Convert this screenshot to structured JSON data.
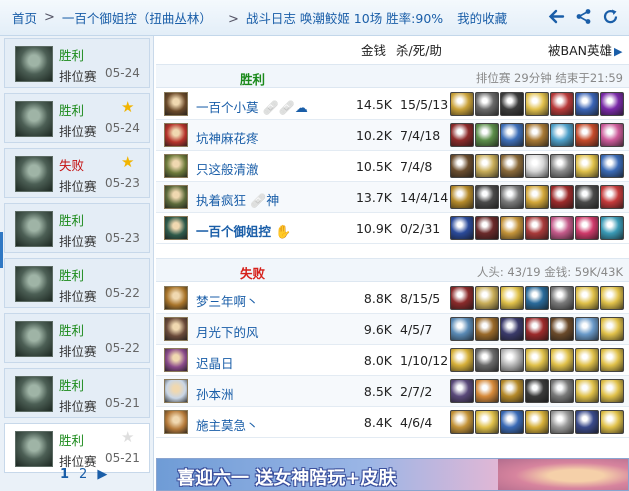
{
  "topbar": {
    "home": "首页",
    "player_crumb": "一百个御姐控（扭曲丛林）",
    "stats_crumb": "战斗日志 唤潮鲛姬 10场 胜率:90%",
    "favorites": "我的收藏",
    "icons": [
      "back-arrow-icon",
      "share-icon",
      "refresh-icon"
    ]
  },
  "games": [
    {
      "result": "胜利",
      "outcome": "win",
      "mode": "排位赛",
      "date": "05-24",
      "star": "none"
    },
    {
      "result": "胜利",
      "outcome": "win",
      "mode": "排位赛",
      "date": "05-24",
      "star": "on"
    },
    {
      "result": "失败",
      "outcome": "lose",
      "mode": "排位赛",
      "date": "05-23",
      "star": "on"
    },
    {
      "result": "胜利",
      "outcome": "win",
      "mode": "排位赛",
      "date": "05-23",
      "star": "none"
    },
    {
      "result": "胜利",
      "outcome": "win",
      "mode": "排位赛",
      "date": "05-22",
      "star": "none"
    },
    {
      "result": "胜利",
      "outcome": "win",
      "mode": "排位赛",
      "date": "05-22",
      "star": "none"
    },
    {
      "result": "胜利",
      "outcome": "win",
      "mode": "排位赛",
      "date": "05-21",
      "star": "none"
    },
    {
      "result": "胜利",
      "outcome": "win",
      "mode": "排位赛",
      "date": "05-21",
      "star": "off"
    }
  ],
  "pager": {
    "page1": "1",
    "page2": "2",
    "next": "▶"
  },
  "columns": {
    "gold": "金钱",
    "kda": "杀/死/助",
    "ban": "被BAN英雄",
    "ban_arrow": "▶"
  },
  "win_team": {
    "result": "胜利",
    "info": "排位赛 29分钟 结束于21:59",
    "players": [
      {
        "name": "一百个小莫",
        "badge": "🩹🩹☁",
        "gold": "14.5K",
        "kda": "15/5/13",
        "self": false,
        "avatar": "#6b4a2a",
        "items": [
          "#caa23a",
          "#6a6a6a",
          "#3c3c3c",
          "#e2c14d",
          "#b73a3a",
          "#3a63b5",
          "#7a2aa8"
        ]
      },
      {
        "name": "坑神麻花疼",
        "badge": "",
        "gold": "10.2K",
        "kda": "7/4/18",
        "self": false,
        "avatar": "#b5322a",
        "items": [
          "#8c2a2a",
          "#5c8e4a",
          "#3e6fb8",
          "#a87934",
          "#4fa0c9",
          "#c54a2a",
          "#cc5b9a"
        ]
      },
      {
        "name": "只这般清澈",
        "badge": "",
        "gold": "10.5K",
        "kda": "7/4/8",
        "self": false,
        "avatar": "#6d7a3a",
        "items": [
          "#6a4d2e",
          "#c9ae5a",
          "#8a6a3a",
          "#d6d6d6",
          "#8a8a8a",
          "#e0c14a",
          "#3a6ab5"
        ]
      },
      {
        "name": "执着疯狂",
        "badge": "🩹神",
        "gold": "13.7K",
        "kda": "14/4/14",
        "self": false,
        "avatar": "#5c6a3a",
        "items": [
          "#b58a2a",
          "#4a4a4a",
          "#7a7a7a",
          "#d4a83a",
          "#9c2a2a",
          "#4a4a4a",
          "#c43a3a"
        ]
      },
      {
        "name": "一百个御姐控",
        "badge": "✋",
        "gold": "10.9K",
        "kda": "0/2/31",
        "self": true,
        "avatar": "#2e5a4a",
        "items": [
          "#2a4a9a",
          "#6a2a2a",
          "#c4943a",
          "#a83a3a",
          "#c45a8a",
          "#cf3a6a",
          "#3a9ab5"
        ]
      }
    ]
  },
  "lose_team": {
    "result": "失败",
    "info": "人头: 43/19 金钱: 59K/43K",
    "players": [
      {
        "name": "梦三年啊丶",
        "badge": "",
        "gold": "8.8K",
        "kda": "8/15/5",
        "self": false,
        "avatar": "#a8742a",
        "items": [
          "#8a2a2a",
          "#c9ae5a",
          "#e0c14a",
          "#2a6a9a",
          "#7a7a7a",
          "#e0c14a",
          "#e0c14a"
        ]
      },
      {
        "name": "月光下的风",
        "badge": "",
        "gold": "9.6K",
        "kda": "4/5/7",
        "self": false,
        "avatar": "#6a4a3a",
        "items": [
          "#5a8ab5",
          "#9a6a2a",
          "#3a3a6a",
          "#9c2a2a",
          "#6a4a2a",
          "#6a9ac9",
          "#e0c14a"
        ]
      },
      {
        "name": "迟晶日",
        "badge": "",
        "gold": "8.0K",
        "kda": "1/10/12",
        "self": false,
        "avatar": "#8a4a8a",
        "items": [
          "#d6b03a",
          "#6a6a6a",
          "#b5b5b5",
          "#e0c14a",
          "#e0c14a",
          "#e0c14a",
          "#e0c14a"
        ]
      },
      {
        "name": "孙本洲",
        "badge": "",
        "gold": "8.5K",
        "kda": "2/7/2",
        "self": false,
        "avatar": "#c9d6e6",
        "items": [
          "#5a4a7a",
          "#d68a3a",
          "#b58a2a",
          "#3a3a3a",
          "#7a7a7a",
          "#e0c14a",
          "#e0c14a"
        ]
      },
      {
        "name": "施主莫急丶",
        "badge": "",
        "gold": "8.4K",
        "kda": "4/6/4",
        "self": false,
        "avatar": "#b57a3a",
        "items": [
          "#c4943a",
          "#e0c14a",
          "#3a6ab5",
          "#d6b03a",
          "#9a9a9a",
          "#3a4a8a",
          "#e0c14a"
        ]
      }
    ]
  },
  "banner": {
    "text": "喜迎六一 送女神陪玩+皮肤"
  }
}
